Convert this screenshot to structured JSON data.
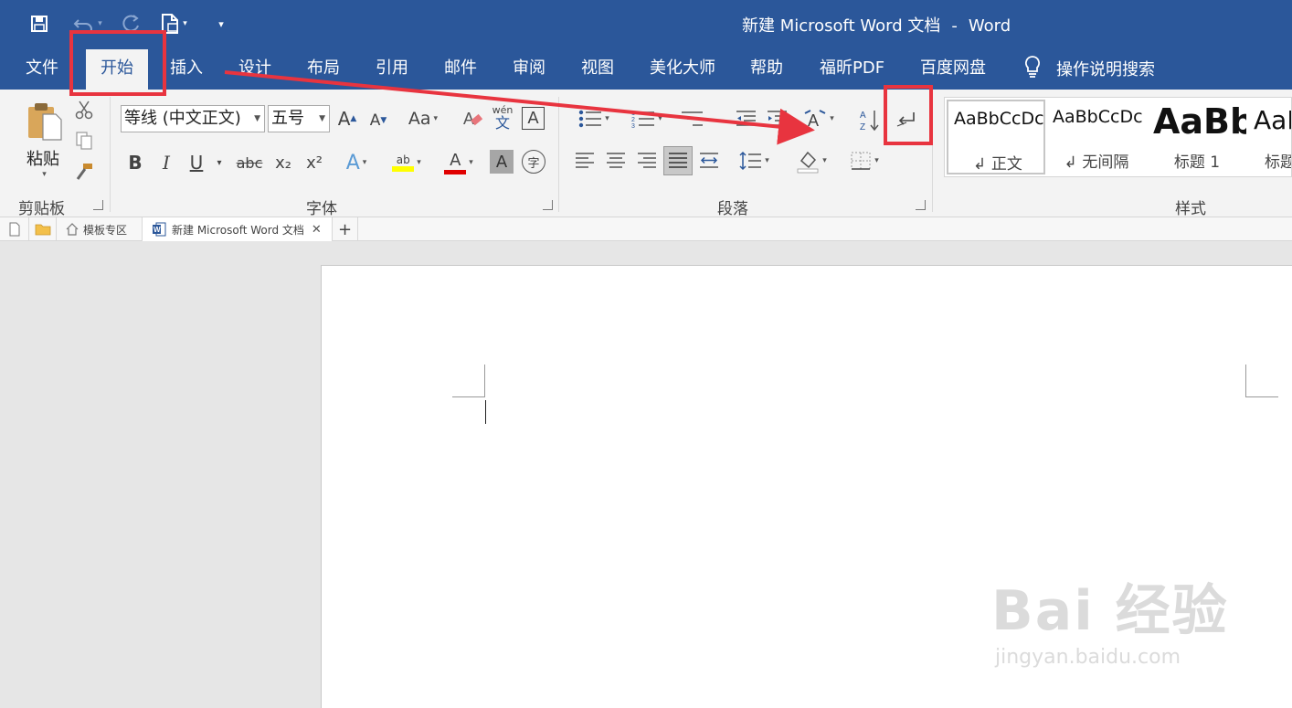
{
  "window": {
    "doc_name": "新建 Microsoft Word 文档",
    "separator": "-",
    "app_name": "Word"
  },
  "quick_access": [
    "save-icon",
    "undo-icon",
    "redo-icon",
    "new-doc-icon",
    "customize-icon"
  ],
  "menu": {
    "tabs": [
      "文件",
      "开始",
      "插入",
      "设计",
      "布局",
      "引用",
      "邮件",
      "审阅",
      "视图",
      "美化大师",
      "帮助",
      "福昕PDF",
      "百度网盘"
    ],
    "active_tab": "开始",
    "tell_me": "操作说明搜索"
  },
  "ribbon": {
    "clipboard": {
      "paste_label": "粘贴",
      "group_label": "剪贴板"
    },
    "font": {
      "font_name": "等线 (中文正文)",
      "font_size": "五号",
      "grow_label": "A",
      "shrink_label": "A",
      "case_label": "Aa",
      "phonetic_top": "wén",
      "phonetic_bottom": "文",
      "border_char": "A",
      "bold": "B",
      "italic": "I",
      "underline": "U",
      "strike": "abc",
      "subscript": "x₂",
      "superscript": "x²",
      "text_effects": "A",
      "highlight": "ab",
      "font_color": "A",
      "char_shading": "A",
      "enclose": "字",
      "group_label": "字体"
    },
    "paragraph": {
      "group_label": "段落"
    },
    "styles": {
      "items": [
        {
          "sample": "AaBbCcDc",
          "name": "↲ 正文"
        },
        {
          "sample": "AaBbCcDc",
          "name": "↲ 无间隔"
        },
        {
          "sample": "AaBb",
          "name": "标题 1"
        },
        {
          "sample": "AaB",
          "name": "标题"
        }
      ],
      "group_label": "样式"
    }
  },
  "doc_tabs": {
    "templates": "模板专区",
    "current": "新建 Microsoft Word 文档",
    "close": "✕",
    "add": "+"
  },
  "watermark": {
    "main": "Bai 经验",
    "sub": "jingyan.baidu.com"
  },
  "colors": {
    "accent": "#2b579a",
    "highlight_box": "#e8343f",
    "highlight_yellow": "#ffff00",
    "font_red": "#e00000"
  }
}
